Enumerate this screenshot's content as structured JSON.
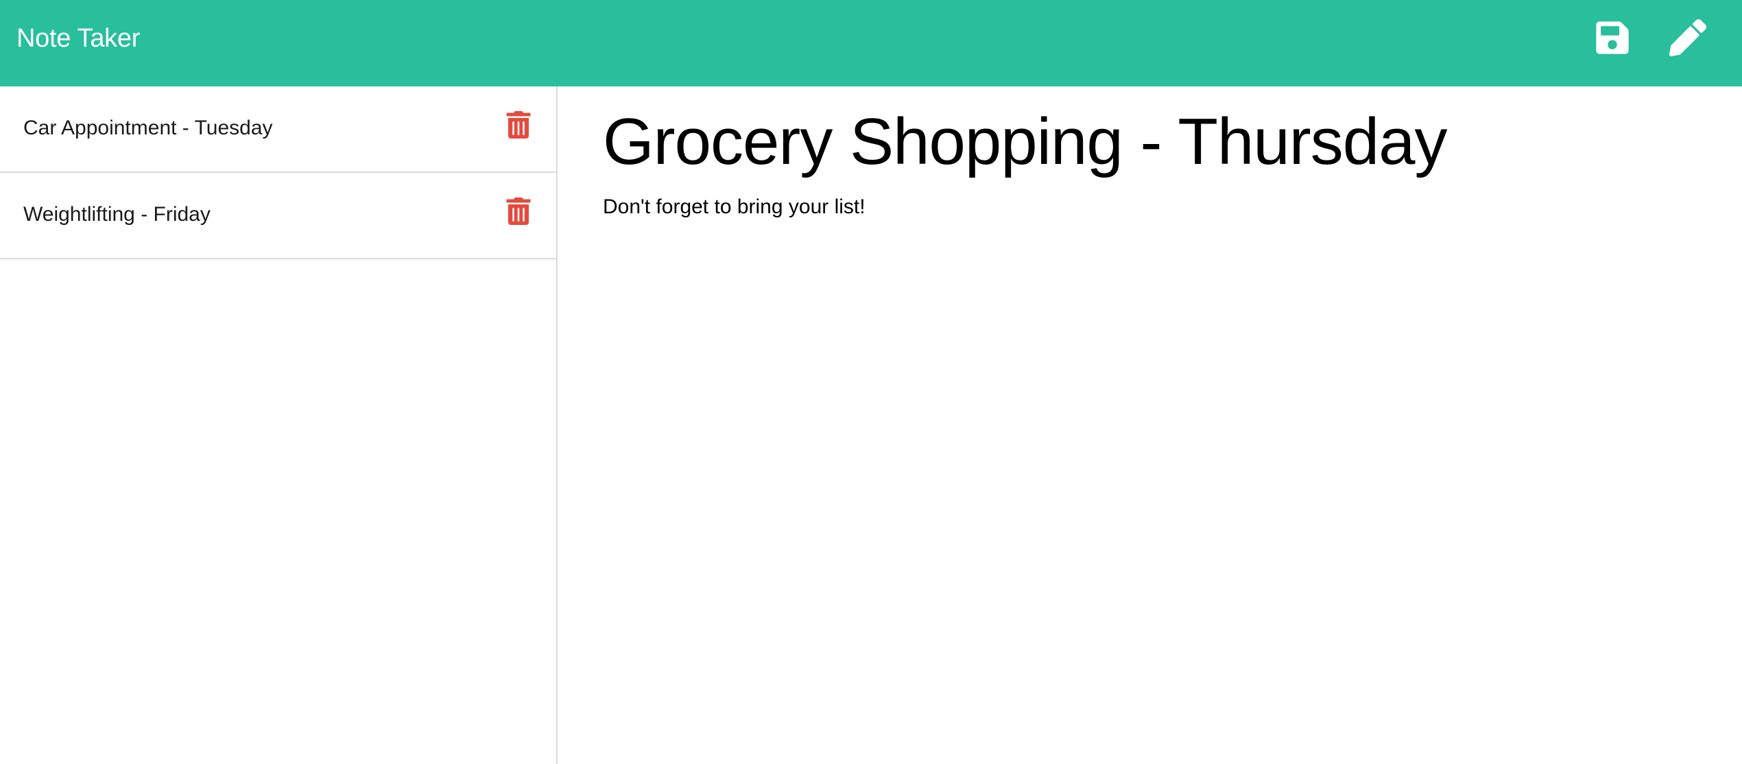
{
  "app": {
    "brand": "Note Taker",
    "accent_color": "#29be9c",
    "delete_color": "#e34b3f"
  },
  "toolbar": {
    "save_icon": "save-icon",
    "write_icon": "pencil-icon"
  },
  "sidebar": {
    "notes": [
      {
        "title": "Car Appointment - Tuesday",
        "delete_icon": "trash-icon"
      },
      {
        "title": "Weightlifting - Friday",
        "delete_icon": "trash-icon"
      }
    ]
  },
  "active_note": {
    "title": "Grocery Shopping - Thursday",
    "text": "Don't forget to bring your list!"
  }
}
